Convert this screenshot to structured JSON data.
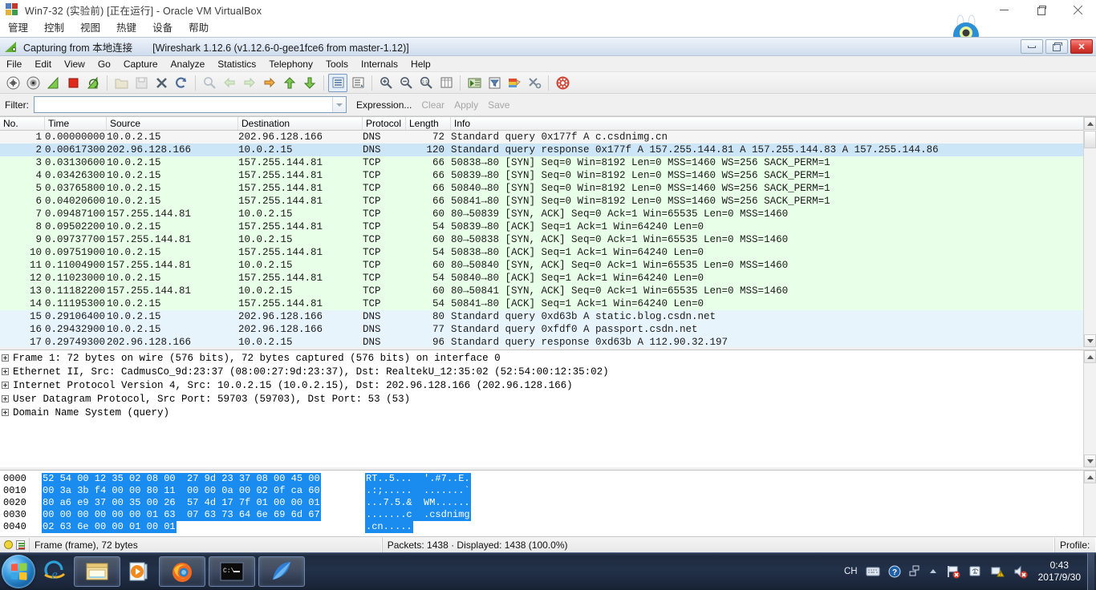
{
  "vbox": {
    "title": "Win7-32 (实验前) [正在运行] - Oracle VM VirtualBox",
    "icon": "virtualbox-icon",
    "menu": [
      "管理",
      "控制",
      "视图",
      "热键",
      "设备",
      "帮助"
    ],
    "window_buttons": [
      "minimize",
      "restore",
      "close"
    ]
  },
  "wireshark": {
    "title_capturing": "Capturing from 本地连接",
    "title_version": "[Wireshark 1.12.6  (v1.12.6-0-gee1fce6 from master-1.12)]",
    "menu": [
      "File",
      "Edit",
      "View",
      "Go",
      "Capture",
      "Analyze",
      "Statistics",
      "Telephony",
      "Tools",
      "Internals",
      "Help"
    ],
    "toolbar_icons": [
      "list-interfaces-icon",
      "capture-options-icon",
      "start-capture-icon",
      "stop-capture-icon",
      "restart-capture-icon",
      "open-file-icon",
      "save-file-icon",
      "close-file-icon",
      "reload-icon",
      "find-packet-icon",
      "go-back-icon",
      "go-forward-icon",
      "go-to-packet-icon",
      "go-first-packet-icon",
      "go-last-packet-icon",
      "colorize-icon",
      "auto-scroll-icon",
      "zoom-in-icon",
      "zoom-out-icon",
      "zoom-reset-icon",
      "resize-columns-icon",
      "capture-filters-icon",
      "display-filters-icon",
      "coloring-rules-icon",
      "preferences-icon",
      "help-icon"
    ],
    "filter": {
      "label": "Filter:",
      "value": "",
      "placeholder": "",
      "dropdown_icon": "chevron-down-icon",
      "expression_label": "Expression...",
      "clear_label": "Clear",
      "apply_label": "Apply",
      "save_label": "Save"
    },
    "packet_list": {
      "columns": [
        "No.",
        "Time",
        "Source",
        "Destination",
        "Protocol",
        "Length",
        "Info"
      ],
      "rows": [
        {
          "no": "1",
          "time": "0.00000000",
          "src": "10.0.2.15",
          "dst": "202.96.128.166",
          "proto": "DNS",
          "len": "72",
          "info": "Standard query 0x177f  A c.csdnimg.cn",
          "style": "first"
        },
        {
          "no": "2",
          "time": "0.00617300",
          "src": "202.96.128.166",
          "dst": "10.0.2.15",
          "proto": "DNS",
          "len": "120",
          "info": "Standard query response 0x177f  A 157.255.144.81 A 157.255.144.83 A 157.255.144.86",
          "style": "dns-sel"
        },
        {
          "no": "3",
          "time": "0.03130600",
          "src": "10.0.2.15",
          "dst": "157.255.144.81",
          "proto": "TCP",
          "len": "66",
          "info": "50838→80 [SYN] Seq=0 Win=8192 Len=0 MSS=1460 WS=256 SACK_PERM=1",
          "style": "tcp"
        },
        {
          "no": "4",
          "time": "0.03426300",
          "src": "10.0.2.15",
          "dst": "157.255.144.81",
          "proto": "TCP",
          "len": "66",
          "info": "50839→80 [SYN] Seq=0 Win=8192 Len=0 MSS=1460 WS=256 SACK_PERM=1",
          "style": "tcp"
        },
        {
          "no": "5",
          "time": "0.03765800",
          "src": "10.0.2.15",
          "dst": "157.255.144.81",
          "proto": "TCP",
          "len": "66",
          "info": "50840→80 [SYN] Seq=0 Win=8192 Len=0 MSS=1460 WS=256 SACK_PERM=1",
          "style": "tcp"
        },
        {
          "no": "6",
          "time": "0.04020600",
          "src": "10.0.2.15",
          "dst": "157.255.144.81",
          "proto": "TCP",
          "len": "66",
          "info": "50841→80 [SYN] Seq=0 Win=8192 Len=0 MSS=1460 WS=256 SACK_PERM=1",
          "style": "tcp"
        },
        {
          "no": "7",
          "time": "0.09487100",
          "src": "157.255.144.81",
          "dst": "10.0.2.15",
          "proto": "TCP",
          "len": "60",
          "info": "80→50839 [SYN, ACK] Seq=0 Ack=1 Win=65535 Len=0 MSS=1460",
          "style": "tcp"
        },
        {
          "no": "8",
          "time": "0.09502200",
          "src": "10.0.2.15",
          "dst": "157.255.144.81",
          "proto": "TCP",
          "len": "54",
          "info": "50839→80 [ACK] Seq=1 Ack=1 Win=64240 Len=0",
          "style": "tcp"
        },
        {
          "no": "9",
          "time": "0.09737700",
          "src": "157.255.144.81",
          "dst": "10.0.2.15",
          "proto": "TCP",
          "len": "60",
          "info": "80→50838 [SYN, ACK] Seq=0 Ack=1 Win=65535 Len=0 MSS=1460",
          "style": "tcp"
        },
        {
          "no": "10",
          "time": "0.09751900",
          "src": "10.0.2.15",
          "dst": "157.255.144.81",
          "proto": "TCP",
          "len": "54",
          "info": "50838→80 [ACK] Seq=1 Ack=1 Win=64240 Len=0",
          "style": "tcp"
        },
        {
          "no": "11",
          "time": "0.11004900",
          "src": "157.255.144.81",
          "dst": "10.0.2.15",
          "proto": "TCP",
          "len": "60",
          "info": "80→50840 [SYN, ACK] Seq=0 Ack=1 Win=65535 Len=0 MSS=1460",
          "style": "tcp"
        },
        {
          "no": "12",
          "time": "0.11023000",
          "src": "10.0.2.15",
          "dst": "157.255.144.81",
          "proto": "TCP",
          "len": "54",
          "info": "50840→80 [ACK] Seq=1 Ack=1 Win=64240 Len=0",
          "style": "tcp"
        },
        {
          "no": "13",
          "time": "0.11182200",
          "src": "157.255.144.81",
          "dst": "10.0.2.15",
          "proto": "TCP",
          "len": "60",
          "info": "80→50841 [SYN, ACK] Seq=0 Ack=1 Win=65535 Len=0 MSS=1460",
          "style": "tcp"
        },
        {
          "no": "14",
          "time": "0.11195300",
          "src": "10.0.2.15",
          "dst": "157.255.144.81",
          "proto": "TCP",
          "len": "54",
          "info": "50841→80 [ACK] Seq=1 Ack=1 Win=64240 Len=0",
          "style": "tcp"
        },
        {
          "no": "15",
          "time": "0.29106400",
          "src": "10.0.2.15",
          "dst": "202.96.128.166",
          "proto": "DNS",
          "len": "80",
          "info": "Standard query 0xd63b  A static.blog.csdn.net",
          "style": "dns"
        },
        {
          "no": "16",
          "time": "0.29432900",
          "src": "10.0.2.15",
          "dst": "202.96.128.166",
          "proto": "DNS",
          "len": "77",
          "info": "Standard query 0xfdf0  A passport.csdn.net",
          "style": "dns"
        },
        {
          "no": "17",
          "time": "0.29749300",
          "src": "202.96.128.166",
          "dst": "10.0.2.15",
          "proto": "DNS",
          "len": "96",
          "info": "Standard query response 0xd63b  A 112.90.32.197",
          "style": "dns"
        }
      ]
    },
    "packet_detail": {
      "rows": [
        "Frame 1: 72 bytes on wire (576 bits), 72 bytes captured (576 bits) on interface 0",
        "Ethernet II, Src: CadmusCo_9d:23:37 (08:00:27:9d:23:37), Dst: RealtekU_12:35:02 (52:54:00:12:35:02)",
        "Internet Protocol Version 4, Src: 10.0.2.15 (10.0.2.15), Dst: 202.96.128.166 (202.96.128.166)",
        "User Datagram Protocol, Src Port: 59703 (59703), Dst Port: 53 (53)",
        "Domain Name System (query)"
      ]
    },
    "packet_bytes": {
      "rows": [
        {
          "offset": "0000",
          "hex": "52 54 00 12 35 02 08 00  27 9d 23 37 08 00 45 00",
          "ascii": "RT..5...  '.#7..E."
        },
        {
          "offset": "0010",
          "hex": "00 3a 3b f4 00 00 80 11  00 00 0a 00 02 0f ca 60",
          "ascii": ".:;.....  .......`"
        },
        {
          "offset": "0020",
          "hex": "80 a6 e9 37 00 35 00 26  57 4d 17 7f 01 00 00 01",
          "ascii": "...7.5.&  WM......"
        },
        {
          "offset": "0030",
          "hex": "00 00 00 00 00 00 01 63  07 63 73 64 6e 69 6d 67",
          "ascii": ".......c  .csdnimg"
        },
        {
          "offset": "0040",
          "hex": "02 63 6e 00 00 01 00 01",
          "ascii": ".cn....."
        }
      ]
    },
    "status_bar": {
      "ready_icon": "capture-status-icon",
      "file_icon": "capture-file-icon",
      "field": "Frame (frame), 72 bytes",
      "counts": "Packets: 1438 · Displayed: 1438 (100.0%)",
      "profile": "Profile: Default"
    },
    "window_buttons": [
      "minimize",
      "restore",
      "close"
    ]
  },
  "taskbar": {
    "start_icon": "windows-start-orb-icon",
    "quick_launch": [
      "internet-explorer-icon",
      "windows-explorer-icon",
      "windows-media-player-icon"
    ],
    "apps": [
      "firefox-icon",
      "command-prompt-icon",
      "wireshark-icon"
    ],
    "tray": {
      "ime": "CH",
      "items": [
        "keyboard-icon",
        "help-icon",
        "network-icon",
        "show-hidden-icons-icon",
        "flag-action-center-icon",
        "usb-safely-remove-icon",
        "network-warning-icon",
        "volume-muted-icon"
      ],
      "time": "0:43",
      "date": "2017/9/30"
    }
  },
  "colors": {
    "dns_row": "#e8f4fc",
    "dns_selected_row": "#cde6f7",
    "tcp_row": "#e8ffe8",
    "first_row": "#f5f5f5",
    "hex_highlight": "#1a8cf0",
    "close_button": "#c12a22"
  }
}
